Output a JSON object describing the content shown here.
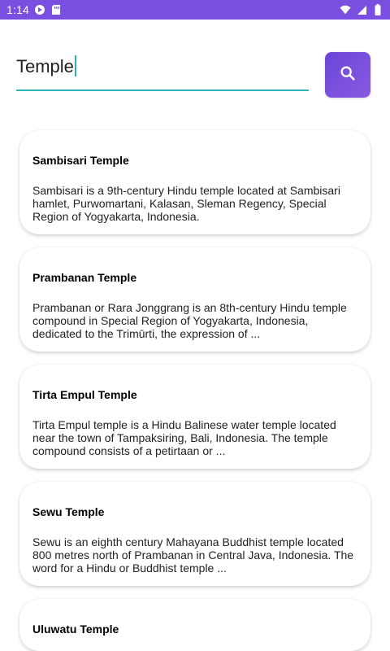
{
  "status_bar": {
    "time": "1:14",
    "background": "#7a4fe0",
    "left_icons": [
      "media-icon",
      "sd-card-icon"
    ],
    "right_icons": [
      "wifi-icon",
      "signal-icon",
      "battery-icon"
    ]
  },
  "search": {
    "value": "Temple",
    "placeholder": "",
    "button_icon": "search-icon",
    "accent": "#2bb3b8",
    "button_color": "#7a4fe0"
  },
  "results": [
    {
      "title": "Sambisari Temple",
      "description": "Sambisari is a 9th-century Hindu temple located at Sambisari hamlet, Purwomartani, Kalasan, Sleman Regency, Special Region of Yogyakarta, Indonesia."
    },
    {
      "title": "Prambanan Temple",
      "description": "Prambanan or Rara Jonggrang is an 8th-century Hindu temple compound in Special Region of Yogyakarta, Indonesia, dedicated to the Trimūrti, the expression of ..."
    },
    {
      "title": "Tirta Empul Temple",
      "description": "Tirta Empul temple is a Hindu Balinese water temple located near the town of Tampaksiring, Bali, Indonesia. The temple compound consists of a petirtaan or ..."
    },
    {
      "title": "Sewu Temple",
      "description": "Sewu is an eighth century Mahayana Buddhist temple located 800 metres north of Prambanan in Central Java, Indonesia. The word for a Hindu or Buddhist temple ..."
    },
    {
      "title": "Uluwatu Temple",
      "description": ""
    }
  ]
}
